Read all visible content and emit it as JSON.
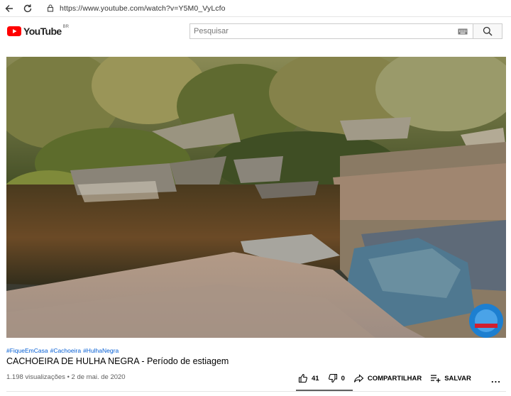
{
  "browser": {
    "url": "https://www.youtube.com/watch?v=Y5M0_VyLcfo"
  },
  "header": {
    "logo_text": "YouTube",
    "country_code": "BR",
    "search_placeholder": "Pesquisar"
  },
  "video": {
    "hashtags": [
      "#FiqueEmCasa",
      "#Cachoeira",
      "#HulhaNegra"
    ],
    "title": "CACHOEIRA DE HULHA NEGRA - Período de estiagem",
    "views": "1.198 visualizações",
    "separator": "•",
    "date": "2 de mai. de 2020",
    "likes": "41",
    "dislikes": "0",
    "share_label": "COMPARTILHAR",
    "save_label": "SALVAR",
    "more_label": "..."
  },
  "colors": {
    "brand_red": "#ff0000",
    "link_blue": "#065fd4",
    "meta_gray": "#606060"
  }
}
